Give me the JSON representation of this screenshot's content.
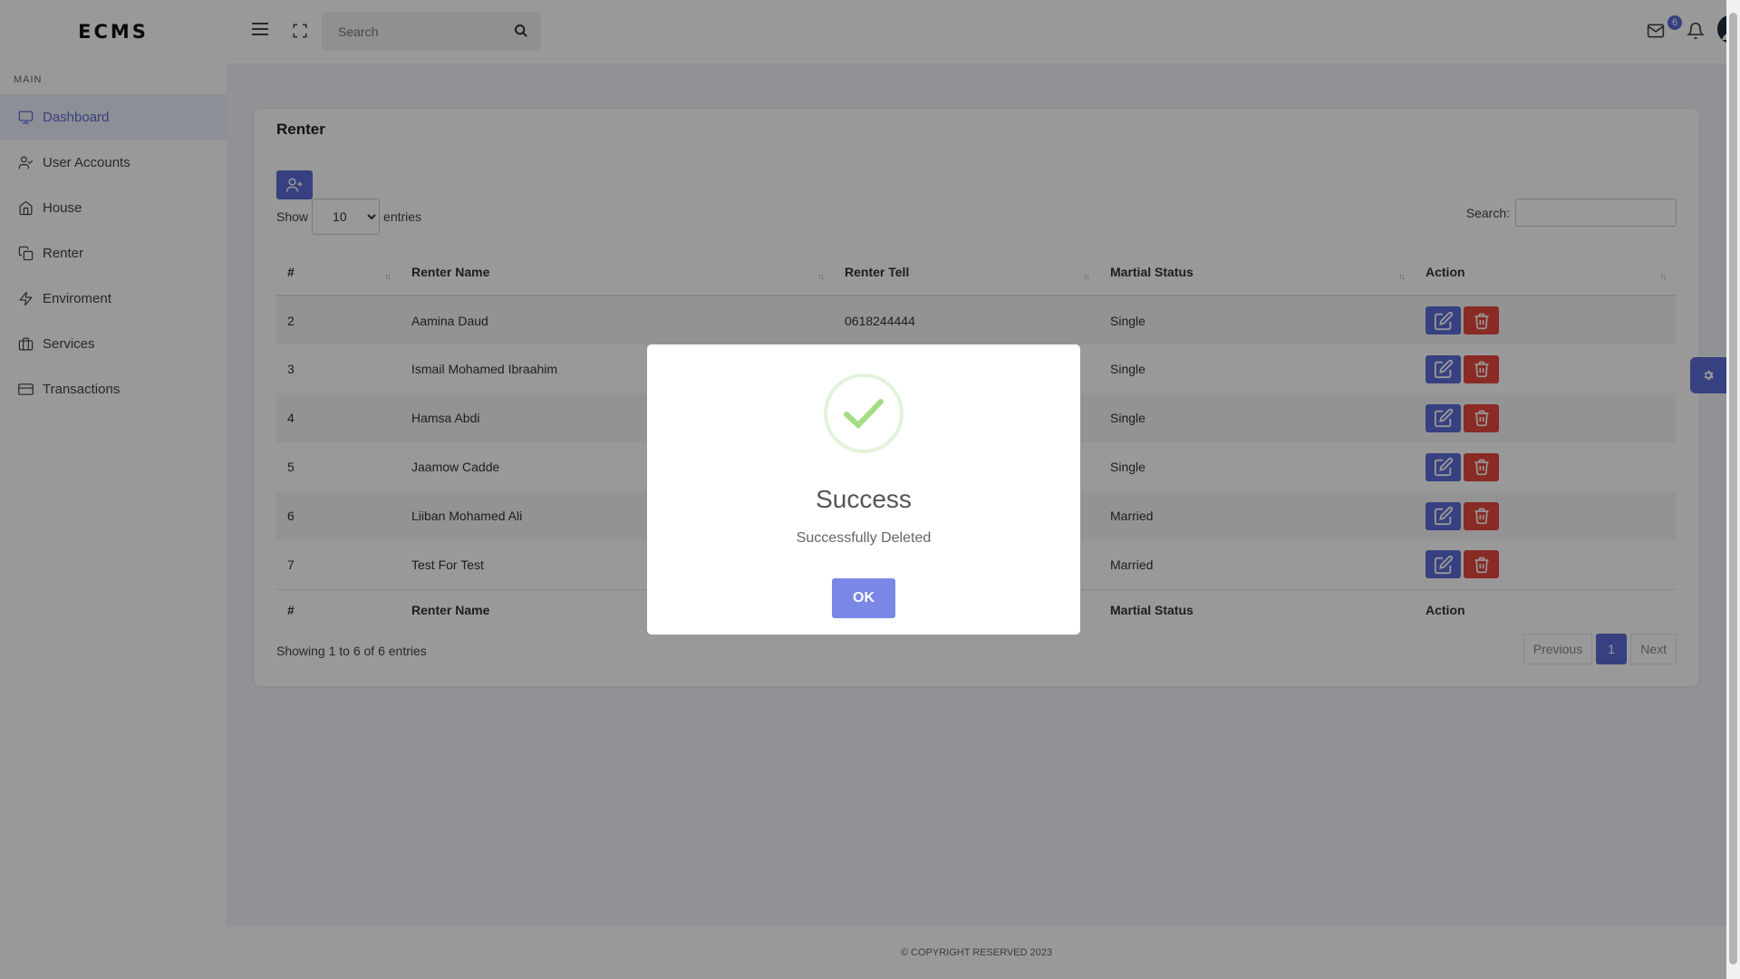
{
  "brand": "ECMS",
  "sidebar": {
    "section": "MAIN",
    "items": [
      {
        "label": "Dashboard",
        "icon": "monitor-icon"
      },
      {
        "label": "User Accounts",
        "icon": "user-check-icon"
      },
      {
        "label": "House",
        "icon": "home-icon"
      },
      {
        "label": "Renter",
        "icon": "copy-icon"
      },
      {
        "label": "Enviroment",
        "icon": "zap-icon"
      },
      {
        "label": "Services",
        "icon": "briefcase-icon"
      },
      {
        "label": "Transactions",
        "icon": "credit-card-icon"
      }
    ]
  },
  "header": {
    "search_placeholder": "Search",
    "mail_badge": "6"
  },
  "card": {
    "title": "Renter",
    "show_label": "Show",
    "entries_label": "entries",
    "page_length": "10",
    "search_label": "Search:",
    "columns": [
      "#",
      "Renter Name",
      "Renter Tell",
      "Martial Status",
      "Action"
    ],
    "rows": [
      {
        "id": "2",
        "name": "Aamina Daud",
        "tell": "0618244444",
        "status": "Single"
      },
      {
        "id": "3",
        "name": "Ismail Mohamed Ibraahim",
        "tell": "",
        "status": "Single"
      },
      {
        "id": "4",
        "name": "Hamsa Abdi",
        "tell": "",
        "status": "Single"
      },
      {
        "id": "5",
        "name": "Jaamow Cadde",
        "tell": "",
        "status": "Single"
      },
      {
        "id": "6",
        "name": "Liiban Mohamed Ali",
        "tell": "",
        "status": "Married"
      },
      {
        "id": "7",
        "name": "Test For Test",
        "tell": "",
        "status": "Married"
      }
    ],
    "footer_columns": [
      "#",
      "Renter Name",
      "",
      "Martial Status",
      "Action"
    ],
    "info": "Showing 1 to 6 of 6 entries",
    "pagination": {
      "previous": "Previous",
      "page": "1",
      "next": "Next"
    }
  },
  "footer": "© COPYRIGHT RESERVED 2023",
  "modal": {
    "title": "Success",
    "text": "Successfully Deleted",
    "button": "OK"
  },
  "colors": {
    "accent": "#5d6bd6",
    "danger": "#e4473f",
    "success": "#a5dc86"
  }
}
